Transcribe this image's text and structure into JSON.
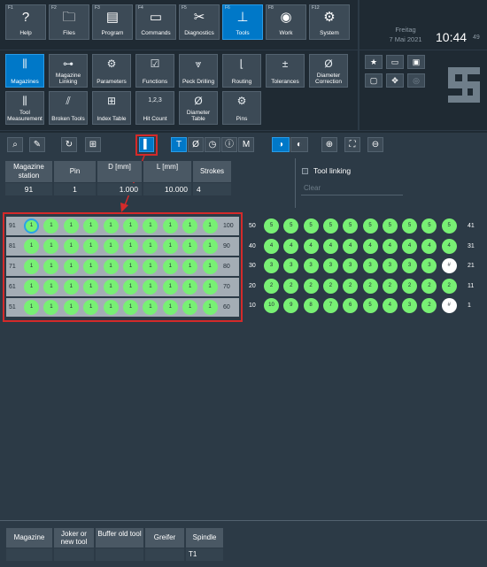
{
  "fkeys": [
    {
      "fnum": "F1",
      "label": "Help",
      "icon": "question-icon",
      "glyph": "?"
    },
    {
      "fnum": "F2",
      "label": "Files",
      "icon": "folder-icon",
      "glyph": "🗀"
    },
    {
      "fnum": "F3",
      "label": "Program",
      "icon": "program-icon",
      "glyph": "▤"
    },
    {
      "fnum": "F4",
      "label": "Commands",
      "icon": "commands-icon",
      "glyph": "▭"
    },
    {
      "fnum": "F5",
      "label": "Diagnostics",
      "icon": "scissors-icon",
      "glyph": "✂"
    },
    {
      "fnum": "F6",
      "label": "Tools",
      "icon": "tools-icon",
      "glyph": "⊥",
      "active": true
    },
    {
      "fnum": "F8",
      "label": "Work",
      "icon": "work-icon",
      "glyph": "◉"
    },
    {
      "fnum": "F12",
      "label": "System",
      "icon": "gears-icon",
      "glyph": "⚙"
    }
  ],
  "datetime": {
    "day": "Freitag",
    "date": "7 Mai 2021",
    "time": "10:44",
    "seconds": "49"
  },
  "toolbar": [
    {
      "label": "Magazines",
      "icon": "magazines-icon",
      "glyph": "⫼",
      "active": true
    },
    {
      "label": "Magazine Linking",
      "icon": "magazine-linking-icon",
      "glyph": "⊶"
    },
    {
      "label": "Parameters",
      "icon": "parameters-icon",
      "glyph": "⚙"
    },
    {
      "label": "Functions",
      "icon": "functions-icon",
      "glyph": "☑"
    },
    {
      "label": "Peck Drilling",
      "icon": "peck-drilling-icon",
      "glyph": "⩔"
    },
    {
      "label": "Routing",
      "icon": "routing-icon",
      "glyph": "⌊"
    },
    {
      "label": "Tolerances",
      "icon": "tolerances-icon",
      "glyph": "±"
    },
    {
      "label": "Diameter Correction",
      "icon": "diameter-correction-icon",
      "glyph": "Ø"
    },
    {
      "label": "Tool Measurement",
      "icon": "tool-measurement-icon",
      "glyph": "⫼"
    },
    {
      "label": "Broken Tools",
      "icon": "broken-tools-icon",
      "glyph": "⫽"
    },
    {
      "label": "Index Table",
      "icon": "index-table-icon",
      "glyph": "⊞"
    },
    {
      "label": "Hit Count",
      "icon": "hit-count-icon",
      "glyph": "1,2,3"
    },
    {
      "label": "Diameter Table",
      "icon": "diameter-table-icon",
      "glyph": "Ø"
    },
    {
      "label": "Pins",
      "icon": "pins-icon",
      "glyph": "⚙"
    }
  ],
  "workbar": {
    "mode_t": "T",
    "mode_d": "Ø",
    "mode_m": "M"
  },
  "info": {
    "headers": [
      "Magazine station",
      "Pin",
      "D [mm]",
      "L [mm]",
      "Strokes"
    ],
    "values": [
      "91",
      "1",
      "1.000",
      "10.000",
      "4"
    ]
  },
  "tool_linking": {
    "label": "Tool linking",
    "clear": "Clear"
  },
  "left_magazine": [
    {
      "start": "91",
      "end": "100",
      "pins": [
        "1",
        "1",
        "1",
        "1",
        "1",
        "1",
        "1",
        "1",
        "1",
        "1"
      ]
    },
    {
      "start": "81",
      "end": "90",
      "pins": [
        "1",
        "1",
        "1",
        "1",
        "1",
        "1",
        "1",
        "1",
        "1",
        "1"
      ]
    },
    {
      "start": "71",
      "end": "80",
      "pins": [
        "1",
        "1",
        "1",
        "1",
        "1",
        "1",
        "1",
        "1",
        "1",
        "1"
      ]
    },
    {
      "start": "61",
      "end": "70",
      "pins": [
        "1",
        "1",
        "1",
        "1",
        "1",
        "1",
        "1",
        "1",
        "1",
        "1"
      ]
    },
    {
      "start": "51",
      "end": "60",
      "pins": [
        "1",
        "1",
        "1",
        "1",
        "1",
        "1",
        "1",
        "1",
        "1",
        "1"
      ]
    }
  ],
  "right_magazine": [
    {
      "start": "50",
      "end": "41",
      "pins": [
        "5",
        "5",
        "5",
        "5",
        "5",
        "5",
        "5",
        "5",
        "5",
        "5"
      ]
    },
    {
      "start": "40",
      "end": "31",
      "pins": [
        "4",
        "4",
        "4",
        "4",
        "4",
        "4",
        "4",
        "4",
        "4",
        "4"
      ]
    },
    {
      "start": "30",
      "end": "21",
      "pins": [
        "3",
        "3",
        "3",
        "3",
        "3",
        "3",
        "3",
        "3",
        "3",
        "#"
      ]
    },
    {
      "start": "20",
      "end": "11",
      "pins": [
        "2",
        "2",
        "2",
        "2",
        "2",
        "2",
        "2",
        "2",
        "2",
        "2"
      ]
    },
    {
      "start": "10",
      "end": "1",
      "pins": [
        "10",
        "9",
        "8",
        "7",
        "6",
        "5",
        "4",
        "3",
        "2",
        "#"
      ]
    }
  ],
  "bottom": {
    "headers": [
      "Magazine",
      "Joker or new tool",
      "Buffer old tool",
      "Greifer",
      "Spindle"
    ],
    "values": [
      "",
      "",
      "",
      "",
      "T1"
    ]
  },
  "colors": {
    "pin_green": "#78f074",
    "pin_white": "#ffffff",
    "active_blue": "#0078c8",
    "highlight_red": "#d42a2a"
  }
}
